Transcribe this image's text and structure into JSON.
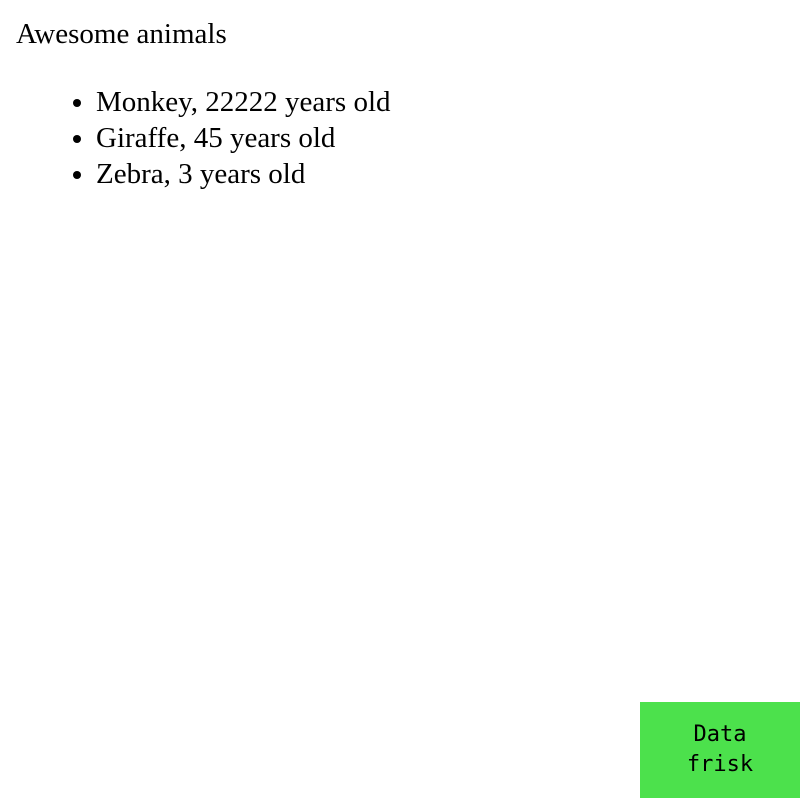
{
  "page": {
    "title": "Awesome animals"
  },
  "animals": [
    {
      "label": "Monkey, 22222 years old"
    },
    {
      "label": "Giraffe, 45 years old"
    },
    {
      "label": "Zebra, 3 years old"
    }
  ],
  "data_frisk": {
    "label": "Data frisk",
    "background": "#4ce14c"
  }
}
